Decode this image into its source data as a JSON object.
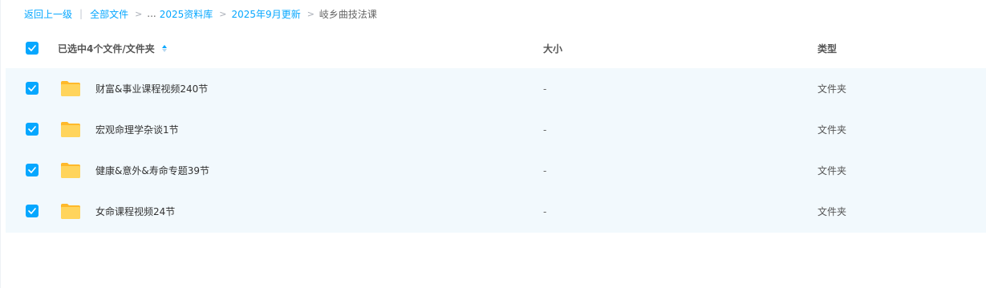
{
  "breadcrumb": {
    "back": "返回上一级",
    "separator": "|",
    "root": "全部文件",
    "ellipsis": "...",
    "level1": "2025资料库",
    "level2": "2025年9月更新",
    "current": "岐乡曲技法课"
  },
  "table": {
    "selection_label": "已选中4个文件/文件夹",
    "col_size": "大小",
    "col_type": "类型",
    "rows": [
      {
        "name": "财富&事业课程视频240节",
        "size": "-",
        "type": "文件夹"
      },
      {
        "name": "宏观命理学杂谈1节",
        "size": "-",
        "type": "文件夹"
      },
      {
        "name": "健康&意外&寿命专题39节",
        "size": "-",
        "type": "文件夹"
      },
      {
        "name": "女命课程视频24节",
        "size": "-",
        "type": "文件夹"
      }
    ]
  },
  "colors": {
    "accent": "#06a7ff",
    "row_selected_bg": "#f2f9fd",
    "folder": "#ffc93d"
  },
  "icons": {
    "checkbox": "check-icon",
    "sort": "sort-icon",
    "folder": "folder-icon"
  }
}
